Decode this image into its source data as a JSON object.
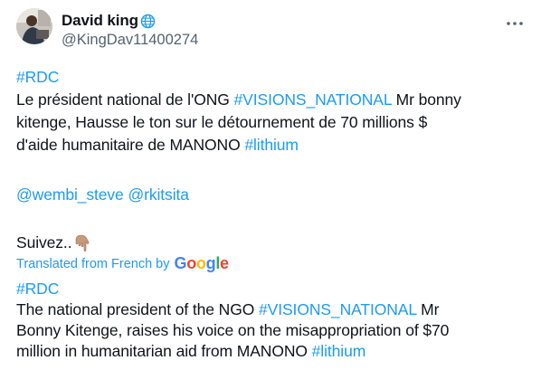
{
  "author": {
    "display_name": "David king",
    "handle": "@KingDav11400274",
    "badge_icon": "globe-icon",
    "avatar_icon": "avatar"
  },
  "menu": {
    "more_icon": "more-horizontal-icon"
  },
  "original": {
    "hashtag_rdc": "#RDC",
    "line1_prefix": "Le président national de l'ONG ",
    "hashtag_visions": "#VISIONS_NATIONAL",
    "line1_suffix": " Mr bonny",
    "line2": "kitenge, Hausse le ton sur le détournement de 70 millions $",
    "line3_prefix": "d'aide humanitaire de MANONO ",
    "hashtag_lithium": "#lithium",
    "mention1": "@wembi_steve",
    "mention2": "@rkitsita",
    "follow_text": "Suivez..",
    "follow_emoji": "pointing-down-icon"
  },
  "translation": {
    "label": "Translated from French by",
    "provider_letters": [
      "G",
      "o",
      "o",
      "g",
      "l",
      "e"
    ],
    "provider_colors": [
      "#4285F4",
      "#EA4335",
      "#FBBC05",
      "#4285F4",
      "#34A853",
      "#EA4335"
    ],
    "hashtag_rdc": "#RDC",
    "line1_prefix": "The national president of the NGO ",
    "hashtag_visions": "#VISIONS_NATIONAL",
    "line1_suffix": " Mr",
    "line2": "Bonny Kitenge, raises his voice on the misappropriation of $70",
    "line3_prefix": "million in humanitarian aid from MANONO ",
    "hashtag_lithium": "#lithium"
  },
  "colors": {
    "link": "#1d9bf0",
    "text": "#0f1419",
    "secondary": "#536471"
  }
}
